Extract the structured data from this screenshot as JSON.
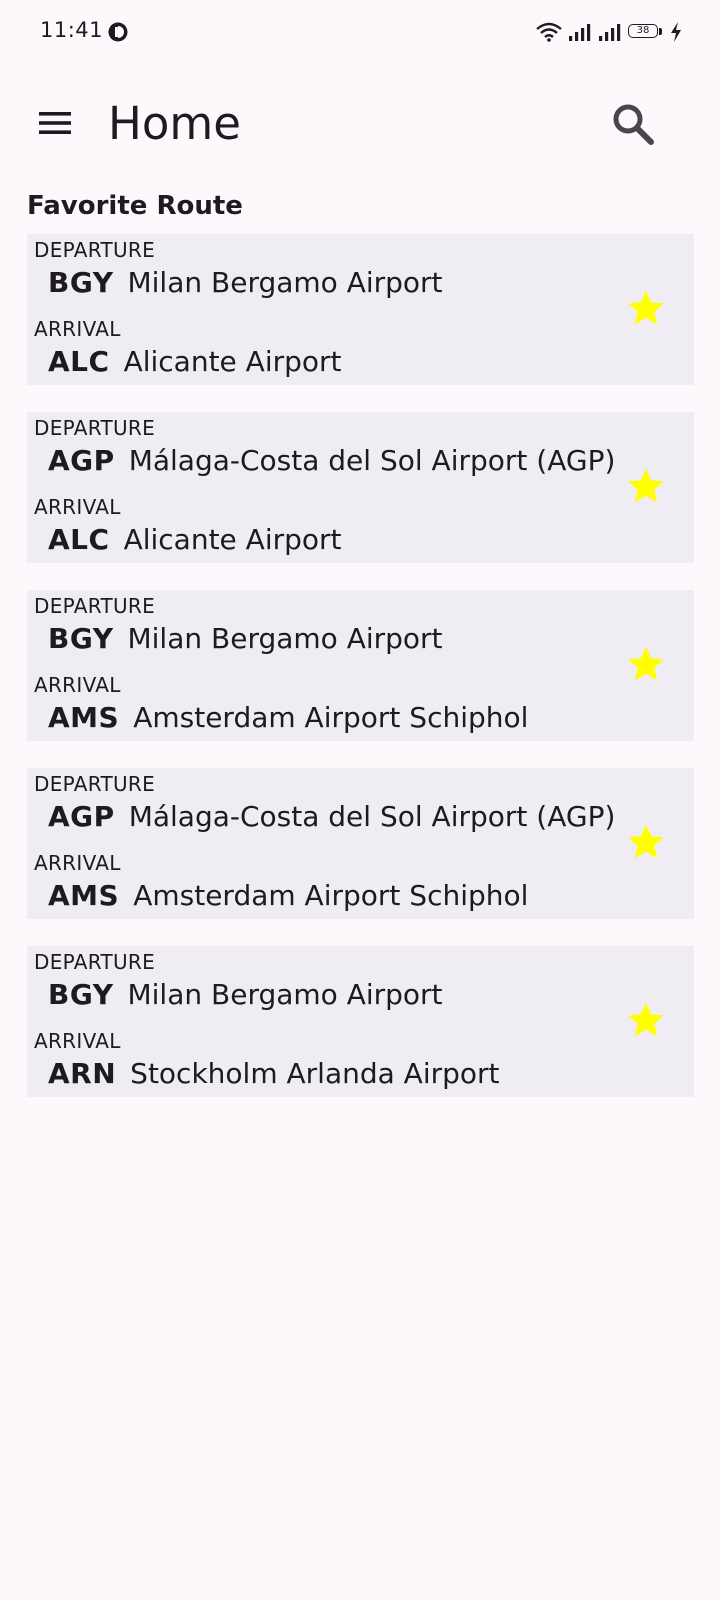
{
  "status_bar": {
    "time": "11:41",
    "battery_level": "38",
    "icons": [
      "app-notification-icon",
      "wifi-icon",
      "cellular-signal-icon",
      "cellular-signal-icon",
      "battery-icon",
      "charging-bolt-icon"
    ]
  },
  "app_bar": {
    "menu_icon": "menu-icon",
    "title": "Home",
    "search_icon": "search-icon"
  },
  "section": {
    "title": "Favorite Route"
  },
  "routes": [
    {
      "departure_label": "DEPARTURE",
      "departure_code": "BGY",
      "departure_name": "Milan Bergamo Airport",
      "arrival_label": "ARRIVAL",
      "arrival_code": "ALC",
      "arrival_name": "Alicante Airport",
      "favorite_icon": "star-icon"
    },
    {
      "departure_label": "DEPARTURE",
      "departure_code": "AGP",
      "departure_name": "Málaga-Costa del Sol Airport (AGP)",
      "arrival_label": "ARRIVAL",
      "arrival_code": "ALC",
      "arrival_name": "Alicante Airport",
      "favorite_icon": "star-icon"
    },
    {
      "departure_label": "DEPARTURE",
      "departure_code": "BGY",
      "departure_name": "Milan Bergamo Airport",
      "arrival_label": "ARRIVAL",
      "arrival_code": "AMS",
      "arrival_name": "Amsterdam Airport Schiphol",
      "favorite_icon": "star-icon"
    },
    {
      "departure_label": "DEPARTURE",
      "departure_code": "AGP",
      "departure_name": "Málaga-Costa del Sol Airport (AGP)",
      "arrival_label": "ARRIVAL",
      "arrival_code": "AMS",
      "arrival_name": "Amsterdam Airport Schiphol",
      "favorite_icon": "star-icon"
    },
    {
      "departure_label": "DEPARTURE",
      "departure_code": "BGY",
      "departure_name": "Milan Bergamo Airport",
      "arrival_label": "ARRIVAL",
      "arrival_code": "ARN",
      "arrival_name": "Stockholm Arlanda Airport",
      "favorite_icon": "star-icon"
    }
  ],
  "colors": {
    "background": "#fdf8fc",
    "card_background": "#f0ecf3",
    "text": "#1d1b20",
    "icon": "#49454f",
    "star": "#ffff00"
  }
}
